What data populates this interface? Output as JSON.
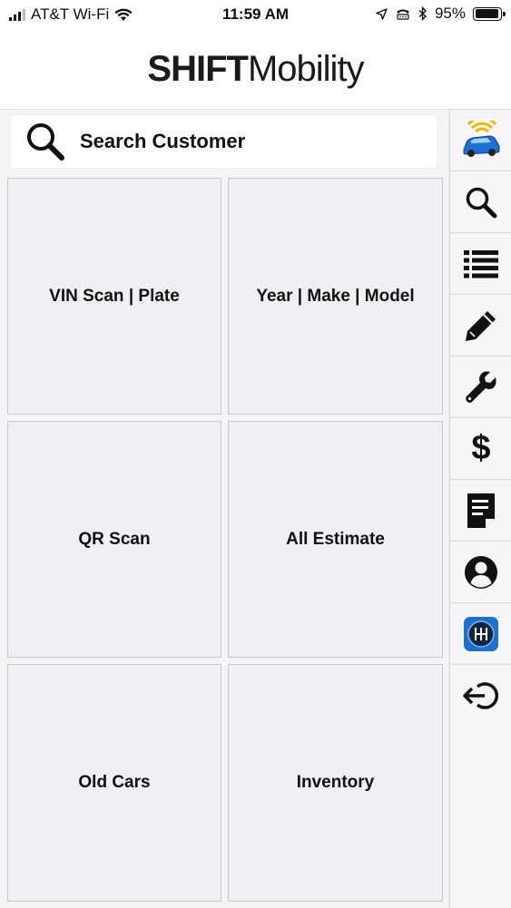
{
  "status_bar": {
    "carrier": "AT&T Wi-Fi",
    "time": "11:59 AM",
    "battery_percent": "95%",
    "battery_level": 0.95
  },
  "header": {
    "logo_bold": "SHIFT",
    "logo_regular": "Mobility"
  },
  "search": {
    "label": "Search Customer",
    "icon": "search-icon"
  },
  "tiles": [
    {
      "label": "VIN Scan | Plate"
    },
    {
      "label": "Year | Make | Model"
    },
    {
      "label": "QR Scan"
    },
    {
      "label": "All Estimate"
    },
    {
      "label": "Old Cars"
    },
    {
      "label": "Inventory"
    }
  ],
  "sidebar": {
    "items": [
      {
        "icon": "connected-car-icon"
      },
      {
        "icon": "search-icon"
      },
      {
        "icon": "list-icon"
      },
      {
        "icon": "pencil-icon"
      },
      {
        "icon": "wrench-icon"
      },
      {
        "icon": "dollar-icon"
      },
      {
        "icon": "document-icon"
      },
      {
        "icon": "user-icon"
      },
      {
        "icon": "gear-shift-icon"
      },
      {
        "icon": "logout-icon"
      }
    ],
    "dollar_glyph": "$"
  },
  "colors": {
    "background": "#f4f4f6",
    "tile": "#f0eff4",
    "tile_border": "#c9c9cc",
    "app_icon_blue": "#1d6fd1",
    "app_icon_yellow": "#f5b800"
  }
}
